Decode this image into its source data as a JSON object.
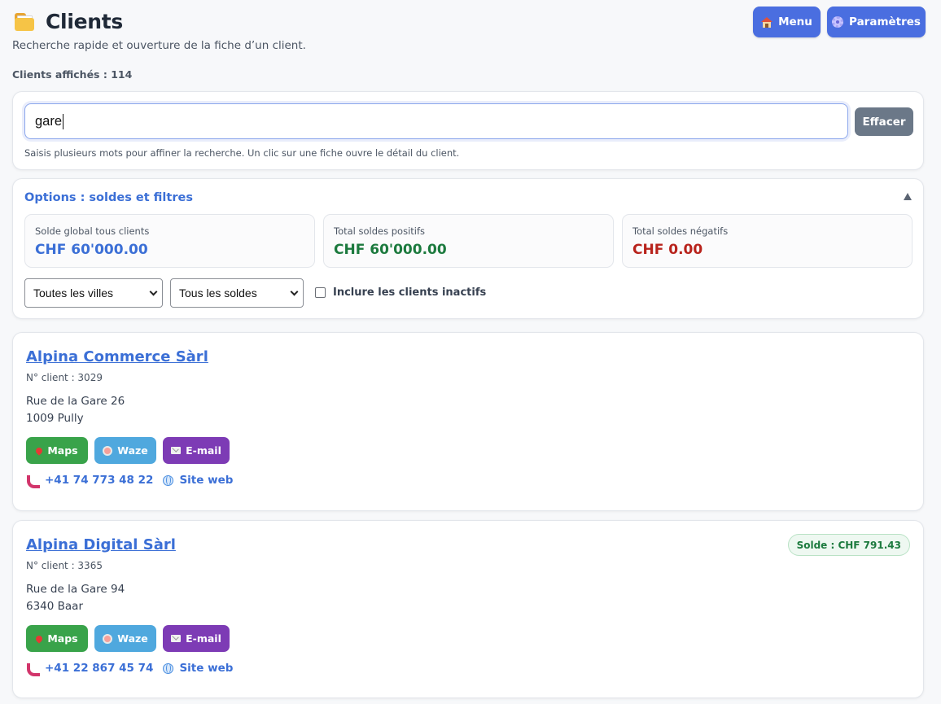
{
  "header": {
    "title": "Clients",
    "subtitle": "Recherche rapide et ouverture de la fiche d’un client.",
    "clients_count_label": "Clients affichés : 114",
    "menu_button": "Menu",
    "settings_button": "Paramètres",
    "icons": {
      "title": "folder-icon",
      "menu": "house-icon",
      "settings": "gear-icon"
    }
  },
  "search": {
    "value": "gare",
    "clear_button": "Effacer",
    "help": "Saisis plusieurs mots pour affiner la recherche. Un clic sur une fiche ouvre le détail du client."
  },
  "options": {
    "title": "Options : soldes et filtres",
    "expanded": true,
    "stats": {
      "global_label": "Solde global tous clients",
      "global_value": "CHF 60'000.00",
      "positive_label": "Total soldes positifs",
      "positive_value": "CHF 60'000.00",
      "negative_label": "Total soldes négatifs",
      "negative_value": "CHF 0.00"
    },
    "city_filter": "Toutes les villes",
    "balance_filter": "Tous les soldes",
    "include_inactive_label": "Inclure les clients inactifs",
    "include_inactive": false
  },
  "clients": [
    {
      "name": "Alpina Commerce Sàrl",
      "number": "N° client : 3029",
      "address_line1": "Rue de la Gare 26",
      "address_line2": "1009 Pully",
      "phone": "+41 74 773 48 22",
      "website_label": "Site web",
      "balance": ""
    },
    {
      "name": "Alpina Digital Sàrl",
      "number": "N° client : 3365",
      "address_line1": "Rue de la Gare 94",
      "address_line2": "6340 Baar",
      "phone": "+41 22 867 45 74",
      "website_label": "Site web",
      "balance": "Solde : CHF 791.43"
    }
  ],
  "actions": {
    "maps": "Maps",
    "waze": "Waze",
    "email": "E-mail"
  },
  "colors": {
    "accent": "#4a6ee0",
    "link": "#3b6fd6",
    "positive": "#1c7a3e",
    "negative": "#b8231c",
    "maps": "#39a34a",
    "waze": "#4fa8de",
    "email": "#7d3bb5"
  }
}
